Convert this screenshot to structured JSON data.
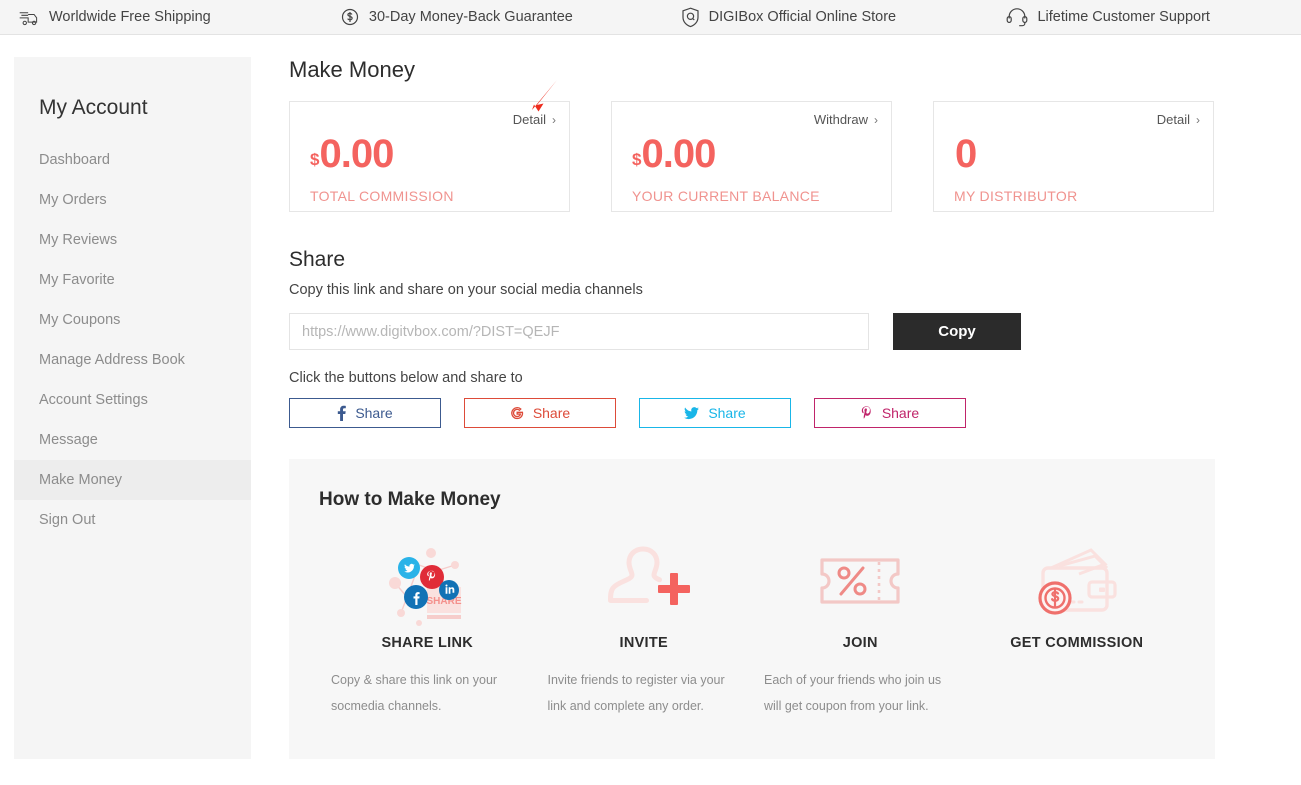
{
  "promo_bar": {
    "items": [
      {
        "icon": "shipping-truck-icon",
        "label": "Worldwide Free Shipping"
      },
      {
        "icon": "money-back-dollar-icon",
        "label": "30-Day Money-Back Guarantee"
      },
      {
        "icon": "shield-store-icon",
        "label": "DIGIBox Official Online Store"
      },
      {
        "icon": "headset-support-icon",
        "label": "Lifetime Customer Support"
      }
    ]
  },
  "sidebar": {
    "title": "My Account",
    "items": [
      {
        "label": "Dashboard",
        "active": false
      },
      {
        "label": "My Orders",
        "active": false
      },
      {
        "label": "My Reviews",
        "active": false
      },
      {
        "label": "My Favorite",
        "active": false
      },
      {
        "label": "My Coupons",
        "active": false
      },
      {
        "label": "Manage Address Book",
        "active": false
      },
      {
        "label": "Account Settings",
        "active": false
      },
      {
        "label": "Message",
        "active": false
      },
      {
        "label": "Make Money",
        "active": true
      },
      {
        "label": "Sign Out",
        "active": false
      }
    ]
  },
  "main": {
    "title": "Make Money",
    "cards": [
      {
        "currency": "$",
        "value": "0.00",
        "label": "TOTAL COMMISSION",
        "link": "Detail",
        "chevron": "›"
      },
      {
        "currency": "$",
        "value": "0.00",
        "label": "YOUR CURRENT BALANCE",
        "link": "Withdraw",
        "chevron": "›"
      },
      {
        "currency": "",
        "value": "0",
        "label": "MY DISTRIBUTOR",
        "link": "Detail",
        "chevron": "›"
      }
    ],
    "annotation": {
      "name": "red-arrow-pointer",
      "color": "#ee2b1c",
      "target": "Detail"
    }
  },
  "share": {
    "heading": "Share",
    "subtitle": "Copy this link and share on your social media channels",
    "link_placeholder": "https://www.digitvbox.com/?DIST=QEJF",
    "link_value": "",
    "copy_label": "Copy",
    "buttons_hint": "Click the buttons below and share to",
    "buttons": [
      {
        "network": "facebook",
        "icon": "facebook-f-icon",
        "label": "Share",
        "color": "#3c5a8f"
      },
      {
        "network": "googleplus",
        "icon": "google-g-icon",
        "label": "Share",
        "color": "#dd4b39"
      },
      {
        "network": "twitter",
        "icon": "twitter-bird-icon",
        "label": "Share",
        "color": "#19b6e8"
      },
      {
        "network": "pinterest",
        "icon": "pinterest-p-icon",
        "label": "Share",
        "color": "#c0246a"
      }
    ]
  },
  "howto": {
    "heading": "How to Make Money",
    "steps": [
      {
        "icon": "share-network-icon",
        "title": "SHARE LINK",
        "desc": "Copy & share this link on your socmedia channels."
      },
      {
        "icon": "user-plus-icon",
        "title": "INVITE",
        "desc": "Invite friends to register via your link and complete any order."
      },
      {
        "icon": "coupon-percent-icon",
        "title": "JOIN",
        "desc": "Each of your friends who join us will get coupon from your link."
      },
      {
        "icon": "wallet-dollar-icon",
        "title": "GET COMMISSION",
        "desc": ""
      }
    ]
  },
  "theme": {
    "accent": "#f4635f",
    "accent_light": "#f0938f",
    "panel_bg": "#f7f7f7",
    "sidebar_bg": "#f5f5f5",
    "dark_button": "#2b2b2b"
  }
}
